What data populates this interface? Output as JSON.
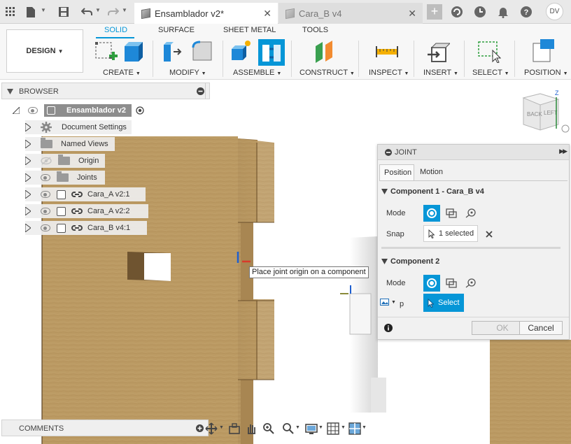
{
  "topbar": {
    "active_tab": "Ensamblador v2*",
    "inactive_tab": "Cara_B v4",
    "user_initials": "DV",
    "close_glyph": "✕"
  },
  "ribbon": {
    "design_label": "DESIGN",
    "tabs": [
      "SOLID",
      "SURFACE",
      "SHEET METAL",
      "TOOLS"
    ],
    "groups": [
      "CREATE",
      "MODIFY",
      "ASSEMBLE",
      "CONSTRUCT",
      "INSPECT",
      "INSERT",
      "SELECT",
      "POSITION"
    ]
  },
  "browser": {
    "title": "BROWSER",
    "root": "Ensamblador v2",
    "items": [
      {
        "label": "Document Settings",
        "icon": "gear-icon"
      },
      {
        "label": "Named Views",
        "icon": "folder-icon"
      },
      {
        "label": "Origin",
        "icon": "folder-icon"
      },
      {
        "label": "Joints",
        "icon": "folder-icon"
      },
      {
        "label": "Cara_A v2:1",
        "icon": "link-icon"
      },
      {
        "label": "Cara_A v2:2",
        "icon": "link-icon"
      },
      {
        "label": "Cara_B v4:1",
        "icon": "link-icon"
      }
    ]
  },
  "comments": {
    "title": "COMMENTS"
  },
  "tooltip": "Place joint origin on a component",
  "viewcube": {
    "back": "BACK",
    "left": "LEFT",
    "axis_z": "Z"
  },
  "joint_panel": {
    "title": "JOINT",
    "tabs": [
      "Position",
      "Motion"
    ],
    "component1": {
      "title": "Component 1 - Cara_B v4",
      "mode_label": "Mode",
      "snap_label": "Snap",
      "snap_value": "1 selected"
    },
    "component2": {
      "title": "Component 2",
      "mode_label": "Mode",
      "p_label": "p",
      "select_label": "Select"
    },
    "ok": "OK",
    "cancel": "Cancel"
  },
  "colors": {
    "accent": "#0696d7",
    "wood": "#b8965f",
    "panel_bg": "#f1f1f1"
  }
}
